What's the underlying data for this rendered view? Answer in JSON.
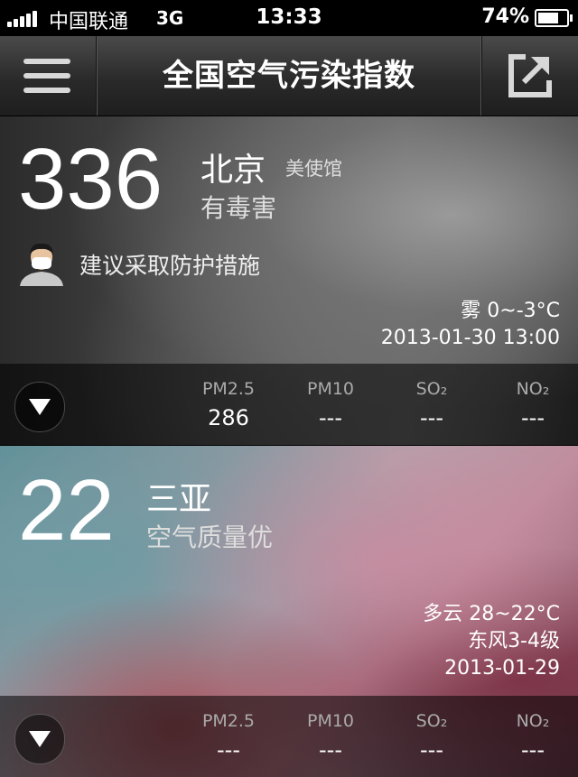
{
  "status_bar": {
    "carrier": "中国联通",
    "network": "3G",
    "time": "13:33",
    "battery_percent": "74%",
    "battery_level": 0.74,
    "signal_bars": 5
  },
  "nav": {
    "title": "全国空气污染指数",
    "menu_icon": "hamburger-menu-icon",
    "share_icon": "share-icon"
  },
  "cards": [
    {
      "aqi": "336",
      "city": "北京",
      "station": "美使馆",
      "level": "有毒害",
      "advice": "建议采取防护措施",
      "weather": "雾 0~-3°C",
      "datetime": "2013-01-30 13:00",
      "pollutants": [
        {
          "label": "PM2.5",
          "value": "286"
        },
        {
          "label": "PM10",
          "value": "---"
        },
        {
          "label": "SO₂",
          "value": "---"
        },
        {
          "label": "NO₂",
          "value": "---"
        }
      ]
    },
    {
      "aqi": "22",
      "city": "三亚",
      "level": "空气质量优",
      "weather": "多云 28~22°C",
      "wind": "东风3-4级",
      "datetime": "2013-01-29",
      "pollutants": [
        {
          "label": "PM2.5",
          "value": "---"
        },
        {
          "label": "PM10",
          "value": "---"
        },
        {
          "label": "SO₂",
          "value": "---"
        },
        {
          "label": "NO₂",
          "value": "---"
        }
      ]
    }
  ],
  "colors": {
    "nav_bg": "#2a2a2a",
    "label_gray": "#aaaaaa"
  }
}
